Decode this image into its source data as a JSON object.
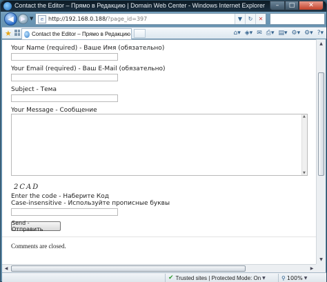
{
  "window": {
    "title": "Contact the Editor – Прямо в Редакцию | Domain Web Center - Windows Internet Explorer",
    "minimize": "–",
    "maximize": "□",
    "close": "✕"
  },
  "address_bar": {
    "url_host": "http://192.168.0.188/",
    "url_path": "?page_id=397"
  },
  "tab": {
    "label": "Contact the Editor – Прямо в Редакцию | Domai..."
  },
  "form": {
    "name_label": "Your Name (required) - Ваше Имя (обязательно)",
    "name_value": "",
    "email_label": "Your Email (required) - Ваш E-Mail (обязательно)",
    "email_value": "",
    "subject_label": "Subject - Тема",
    "subject_value": "",
    "message_label": "Your Message - Сообщение",
    "message_value": "",
    "captcha_text": "2CAD",
    "code_label": "Enter the code - Наберите Код",
    "case_label": "Case-insensitive - Используйте прописные буквы",
    "code_value": "",
    "send_label": "Send - Отправить"
  },
  "comments_closed": "Comments are closed.",
  "status": {
    "zone": "Trusted sites | Protected Mode: On",
    "zoom": "100%"
  },
  "icons": {
    "back": "arrow-left-icon",
    "forward": "arrow-right-icon",
    "favorites": "star-icon",
    "trusted": "checkmark-icon"
  },
  "colors": {
    "title_bar": "#1c3142",
    "close_button": "#c2412a",
    "favorites_star": "#e7a617",
    "trusted_check": "#2d9a2d"
  }
}
